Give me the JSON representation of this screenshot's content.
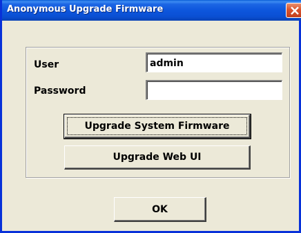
{
  "window": {
    "title": "Anonymous Upgrade Firmware"
  },
  "form": {
    "user_label": "User",
    "user_value": "admin",
    "password_label": "Password",
    "password_value": ""
  },
  "buttons": {
    "upgrade_system": "Upgrade System Firmware",
    "upgrade_webui": "Upgrade Web UI",
    "ok": "OK"
  },
  "icons": {
    "close": "close-icon"
  },
  "colors": {
    "titlebar": "#0a4fd3",
    "close_button": "#d9542f",
    "window_bg": "#ece9d8"
  }
}
